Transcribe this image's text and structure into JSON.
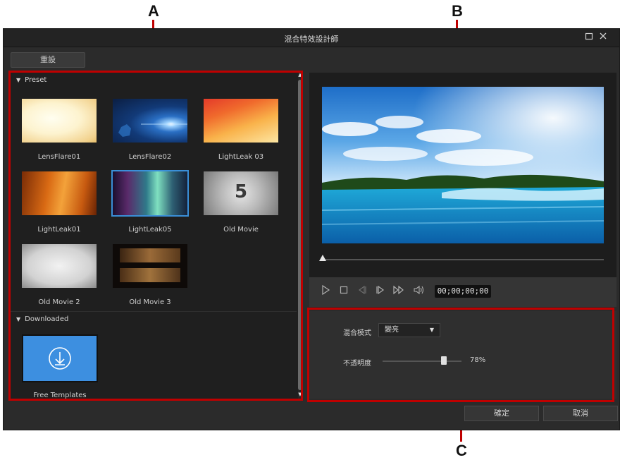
{
  "callouts": {
    "a": "A",
    "b": "B",
    "c": "C"
  },
  "window": {
    "title": "混合特效設計師"
  },
  "toolbar": {
    "reset_label": "重設"
  },
  "sections": {
    "preset": "Preset",
    "downloaded": "Downloaded"
  },
  "presets": [
    {
      "label": "LensFlare01"
    },
    {
      "label": "LensFlare02"
    },
    {
      "label": "LightLeak 03"
    },
    {
      "label": "LightLeak01"
    },
    {
      "label": "LightLeak05"
    },
    {
      "label": "Old Movie"
    },
    {
      "label": "Old Movie 2"
    },
    {
      "label": "Old Movie 3"
    }
  ],
  "old_movie_number": "5",
  "downloaded": [
    {
      "label": "Free Templates"
    }
  ],
  "player": {
    "timecode": "00;00;00;00",
    "seek_position": 0
  },
  "settings": {
    "blend_mode_label": "混合模式",
    "blend_mode_value": "變亮",
    "opacity_label": "不透明度",
    "opacity_value": "78%",
    "opacity_level": 0.78
  },
  "buttons": {
    "ok": "確定",
    "cancel": "取消"
  },
  "colors": {
    "highlight": "#c00000",
    "selected_border": "#3a8fd8",
    "download_tile": "#3d8fe0"
  }
}
